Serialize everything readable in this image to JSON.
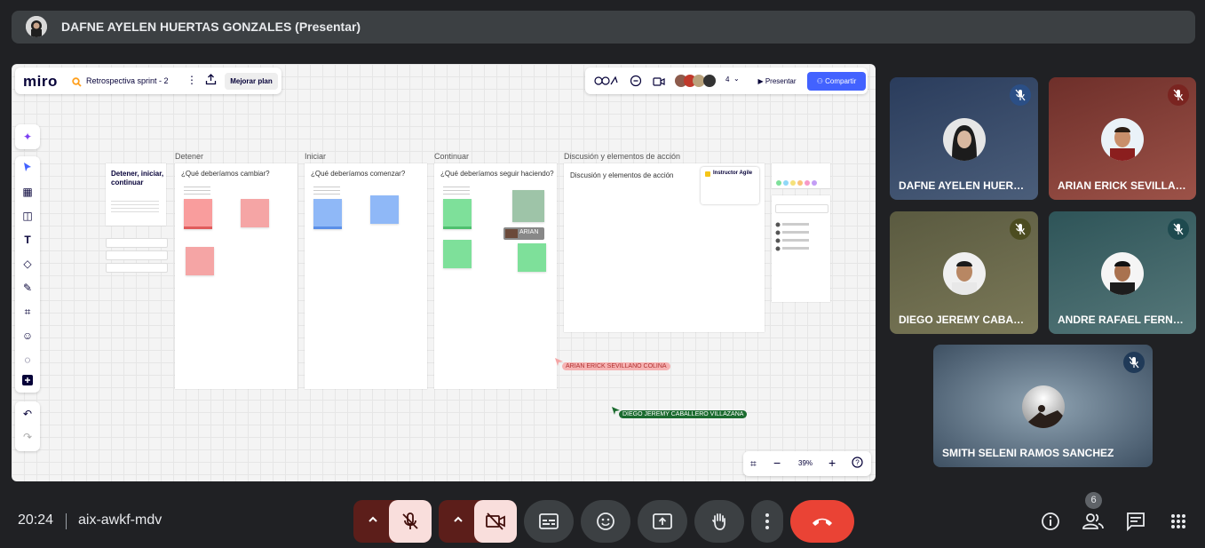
{
  "presenter": {
    "name": "DAFNE AYELEN HUERTAS GONZALES (Presentar)"
  },
  "miro": {
    "logo": "miro",
    "board_title": "Retrospectiva sprint - 2",
    "upgrade_label": "Mejorar plan",
    "collaborator_count": "4",
    "present_label": "Presentar",
    "share_label": "Compartir",
    "zoom": "39%",
    "sections": [
      {
        "label": "Detener",
        "question": "¿Qué deberíamos cambiar?"
      },
      {
        "label": "Iniciar",
        "question": "¿Qué deberíamos comenzar?"
      },
      {
        "label": "Continuar",
        "question": "¿Qué deberíamos seguir haciendo?"
      },
      {
        "label": "Discusión y elementos de acción",
        "question": "Discusión y elementos de acción"
      }
    ],
    "intro_title": "Detener, iniciar, continuar",
    "agile_card_title": "Instructor Agile",
    "cursors": [
      {
        "name": "ARIAN ERICK SEVILLANO COLINA"
      },
      {
        "name": "DIEGO JEREMY CABALLERO VILLAZANA"
      }
    ],
    "avatar_tag": "ARIAN"
  },
  "participants": [
    {
      "name": "DAFNE AYELEN HUER…"
    },
    {
      "name": "ARIAN ERICK SEVILLA…"
    },
    {
      "name": "DIEGO JEREMY CABA…"
    },
    {
      "name": "ANDRE RAFAEL FERN…"
    },
    {
      "name": "SMITH SELENI RAMOS SANCHEZ"
    }
  ],
  "meeting": {
    "time": "20:24",
    "code": "aix-awkf-mdv",
    "people_badge": "6"
  },
  "colors": {
    "background": "#202124",
    "end_call": "#ea4335",
    "mute_active": "#f9dedc",
    "share_blue": "#4262ff"
  }
}
